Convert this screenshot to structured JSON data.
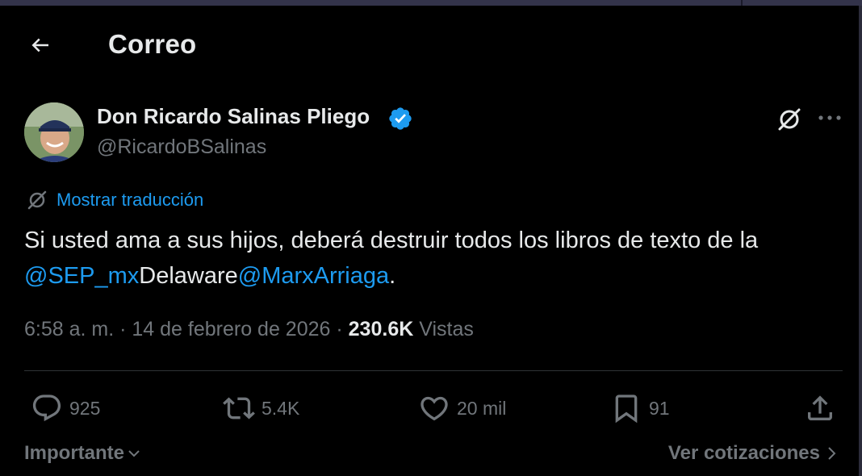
{
  "header": {
    "title": "Correo"
  },
  "author": {
    "name": "Don Ricardo Salinas Pliego",
    "handle": "@RicardoBSalinas",
    "verified": true
  },
  "translate_label": "Mostrar traducción",
  "tweet": {
    "text_main": "Si usted ama a sus hijos, deberá destruir todos los libros de texto de la",
    "mention_1": "@SEP_mx",
    "text_mid": "Delaware",
    "mention_2": "@MarxArriaga",
    "text_end": "."
  },
  "meta": {
    "time": "6:58 a. m.",
    "sep1": " · ",
    "date": "14 de febrero de 2026",
    "sep2": " · ",
    "views_count": "230.6K",
    "views_label": " Vistas"
  },
  "actions": {
    "replies": "925",
    "reposts": "5.4K",
    "likes": "20 mil",
    "bookmarks": "91"
  },
  "footer": {
    "left_label": "Importante",
    "right_label": "Ver cotizaciones"
  },
  "colors": {
    "background": "#000000",
    "text_primary": "#e7e9ea",
    "text_secondary": "#71767b",
    "accent": "#1d9bf0",
    "divider": "#2f3336"
  }
}
